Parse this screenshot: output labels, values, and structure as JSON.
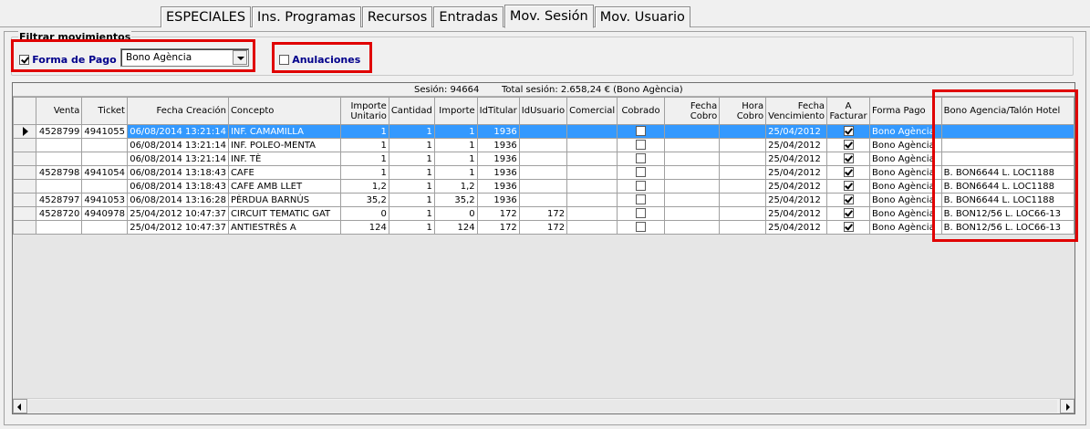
{
  "tabs": [
    "ESPECIALES",
    "Ins. Programas",
    "Recursos",
    "Entradas",
    "Mov. Sesión",
    "Mov. Usuario"
  ],
  "active_tab": "Mov. Sesión",
  "filter": {
    "legend": "Filtrar movimientos",
    "payment_label": "Forma de Pago",
    "payment_checked": true,
    "payment_value": "Bono Agència",
    "cancel_label": "Anulaciones",
    "cancel_checked": false
  },
  "summary": {
    "session": "Sesión: 94664",
    "total": "Total sesión: 2.658,24 € (Bono Agència)"
  },
  "columns": [
    "Venta",
    "Ticket",
    "Fecha Creación",
    "Concepto",
    "Importe Unitario",
    "Cantidad",
    "Importe",
    "IdTitular",
    "IdUsuario",
    "Comercial",
    "Cobrado",
    "Fecha Cobro",
    "Hora Cobro",
    "Fecha Vencimiento",
    "A Facturar",
    "Forma Pago",
    "Bono Agencia/Talón Hotel"
  ],
  "rows": [
    [
      "4528799",
      "4941055",
      "06/08/2014 13:21:14",
      "INF. CAMAMILLA",
      "1",
      "1",
      "1",
      "1936",
      "",
      "",
      "",
      "",
      "",
      "25/04/2012",
      "",
      "Bono Agència",
      ""
    ],
    [
      "",
      "",
      "06/08/2014 13:21:14",
      "INF. POLEO-MENTA",
      "1",
      "1",
      "1",
      "1936",
      "",
      "",
      "",
      "",
      "",
      "25/04/2012",
      "",
      "Bono Agència",
      ""
    ],
    [
      "",
      "",
      "06/08/2014 13:21:14",
      "INF. TÈ",
      "1",
      "1",
      "1",
      "1936",
      "",
      "",
      "",
      "",
      "",
      "25/04/2012",
      "",
      "Bono Agència",
      ""
    ],
    [
      "4528798",
      "4941054",
      "06/08/2014 13:18:43",
      "CAFE",
      "1",
      "1",
      "1",
      "1936",
      "",
      "",
      "",
      "",
      "",
      "25/04/2012",
      "",
      "Bono Agència",
      "B. BON6644 L. LOC1188"
    ],
    [
      "",
      "",
      "06/08/2014 13:18:43",
      "CAFE AMB LLET",
      "1,2",
      "1",
      "1,2",
      "1936",
      "",
      "",
      "",
      "",
      "",
      "25/04/2012",
      "",
      "Bono Agència",
      "B. BON6644 L. LOC1188"
    ],
    [
      "4528797",
      "4941053",
      "06/08/2014 13:16:28",
      "PÈRDUA BARNÚS",
      "35,2",
      "1",
      "35,2",
      "1936",
      "",
      "",
      "",
      "",
      "",
      "25/04/2012",
      "",
      "Bono Agència",
      "B. BON6644 L. LOC1188"
    ],
    [
      "4528720",
      "4940978",
      "25/04/2012 10:47:37",
      "CIRCUIT TEMATIC GAT",
      "0",
      "1",
      "0",
      "172",
      "172",
      "",
      "",
      "",
      "",
      "25/04/2012",
      "",
      "Bono Agència",
      "B. BON12/56 L. LOC66-13"
    ],
    [
      "",
      "",
      "25/04/2012 10:47:37",
      "ANTIESTRÈS A",
      "124",
      "1",
      "124",
      "172",
      "172",
      "",
      "",
      "",
      "",
      "25/04/2012",
      "",
      "Bono Agència",
      "B. BON12/56 L. LOC66-13"
    ]
  ],
  "cobrado": [
    false,
    false,
    false,
    false,
    false,
    false,
    false,
    false
  ],
  "a_facturar": [
    true,
    true,
    true,
    true,
    true,
    true,
    true,
    true
  ],
  "selected_row": 0
}
